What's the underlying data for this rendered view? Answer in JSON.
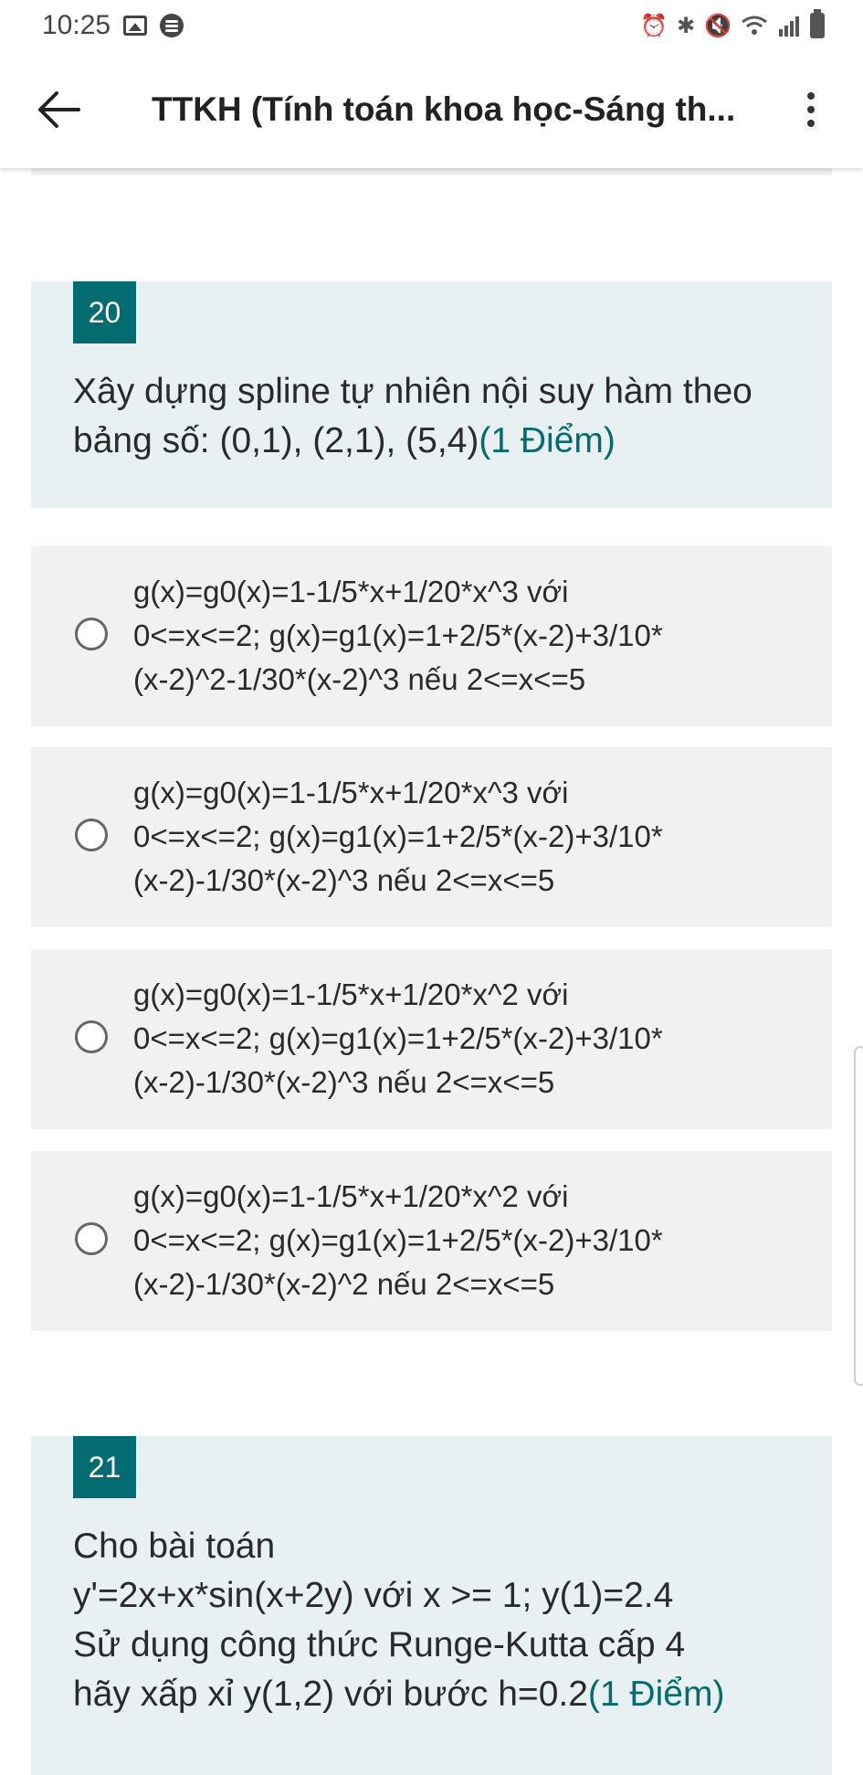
{
  "status_bar": {
    "time": "10:25",
    "left_icons": [
      "image-icon",
      "spotify-icon"
    ],
    "right_icons": [
      "alarm-icon",
      "bluetooth-icon",
      "mute-icon",
      "wifi-icon",
      "signal-icon",
      "battery-icon"
    ]
  },
  "app_bar": {
    "title": "TTKH (Tính toán khoa học-Sáng th...",
    "back_icon": "arrow-left-icon",
    "more_icon": "more-vertical-icon"
  },
  "colors": {
    "accent": "#036c70",
    "question_background": "#e9f0f1",
    "option_background": "#f1f1f1"
  },
  "questions": [
    {
      "number": "20",
      "text": "Xây dựng spline tự nhiên nội suy hàm theo bảng số: (0,1), (2,1), (5,4)",
      "points": "(1 Điểm)",
      "options": [
        {
          "line1": "g(x)=g0(x)=1-1/5*x+1/20*x^3 với",
          "line2": "0<=x<=2; g(x)=g1(x)=1+2/5*(x-2)+3/10*",
          "line3": "(x-2)^2-1/30*(x-2)^3 nếu 2<=x<=5"
        },
        {
          "line1": "g(x)=g0(x)=1-1/5*x+1/20*x^3 với",
          "line2": "0<=x<=2; g(x)=g1(x)=1+2/5*(x-2)+3/10*",
          "line3": "(x-2)-1/30*(x-2)^3 nếu 2<=x<=5"
        },
        {
          "line1": "g(x)=g0(x)=1-1/5*x+1/20*x^2 với",
          "line2": "0<=x<=2; g(x)=g1(x)=1+2/5*(x-2)+3/10*",
          "line3": "(x-2)-1/30*(x-2)^3 nếu 2<=x<=5"
        },
        {
          "line1": "g(x)=g0(x)=1-1/5*x+1/20*x^2 với",
          "line2": "0<=x<=2; g(x)=g1(x)=1+2/5*(x-2)+3/10*",
          "line3": "(x-2)-1/30*(x-2)^2 nếu 2<=x<=5"
        }
      ]
    },
    {
      "number": "21",
      "line1": "Cho bài toán",
      "line2": "y'=2x+x*sin(x+2y) với x >= 1; y(1)=2.4",
      "line3": "Sử dụng công thức Runge-Kutta cấp 4",
      "line4": "hãy xấp xỉ y(1,2) với bước h=0.2",
      "points": "(1 Điểm)"
    }
  ]
}
